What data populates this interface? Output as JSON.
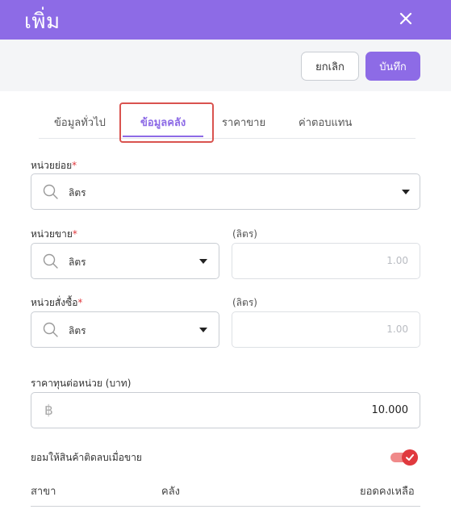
{
  "header": {
    "title": "เพิ่ม"
  },
  "actions": {
    "cancel_label": "ยกเลิก",
    "save_label": "บันทึก"
  },
  "tabs": [
    {
      "label": "ข้อมูลทั่วไป",
      "active": false
    },
    {
      "label": "ข้อมูลคลัง",
      "active": true
    },
    {
      "label": "ราคาขาย",
      "active": false
    },
    {
      "label": "ค่าตอบแทน",
      "active": false
    }
  ],
  "form": {
    "sub_unit": {
      "label": "หน่วยย่อย",
      "required": "*",
      "value": "ลิตร"
    },
    "sale_unit": {
      "label": "หน่วยขาย",
      "required": "*",
      "value": "ลิตร",
      "unit_label": "(ลิตร)",
      "ratio": "1.00"
    },
    "order_unit": {
      "label": "หน่วยสั่งซื้อ",
      "required": "*",
      "value": "ลิตร",
      "unit_label": "(ลิตร)",
      "ratio": "1.00"
    },
    "cost_per_unit": {
      "label": "ราคาทุนต่อหน่วย (บาท)",
      "currency_symbol": "฿",
      "value": "10.000"
    },
    "allow_negative": {
      "label": "ยอมให้สินค้าติดลบเมื่อขาย",
      "enabled": true
    }
  },
  "table": {
    "columns": [
      "สาขา",
      "คลัง",
      "ยอดคงเหลือ"
    ]
  },
  "colors": {
    "accent": "#8d6be6",
    "toggle_on": "#e0393e",
    "highlight": "#d9534f"
  },
  "icons": [
    "close-icon",
    "search-icon",
    "chevron-down-icon",
    "baht-icon",
    "check-icon"
  ]
}
